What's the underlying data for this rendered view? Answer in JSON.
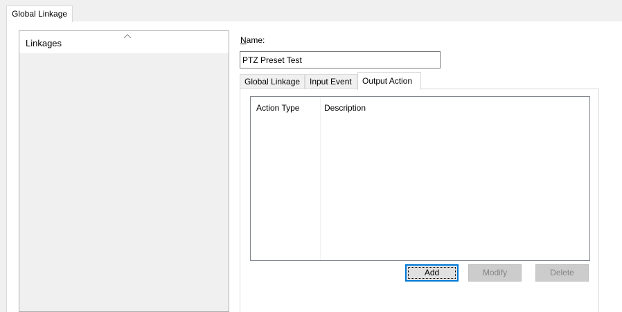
{
  "window_tab": {
    "label": "Global Linkage"
  },
  "linkages": {
    "header": "Linkages",
    "items": []
  },
  "name_field": {
    "label_accel": "N",
    "label_rest": "ame:",
    "value": "PTZ Preset Test"
  },
  "tabs": [
    {
      "label": "Global Linkage",
      "active": false
    },
    {
      "label": "Input Event",
      "active": false
    },
    {
      "label": "Output Action",
      "active": true
    }
  ],
  "actions_list": {
    "columns": [
      "Action Type",
      "Description"
    ],
    "rows": []
  },
  "buttons": {
    "add": "Add",
    "modify": "Modify",
    "delete": "Delete"
  },
  "colors": {
    "focus_border": "#0078d7",
    "disabled_text": "#838383",
    "window_bg": "#f0f0f0"
  }
}
